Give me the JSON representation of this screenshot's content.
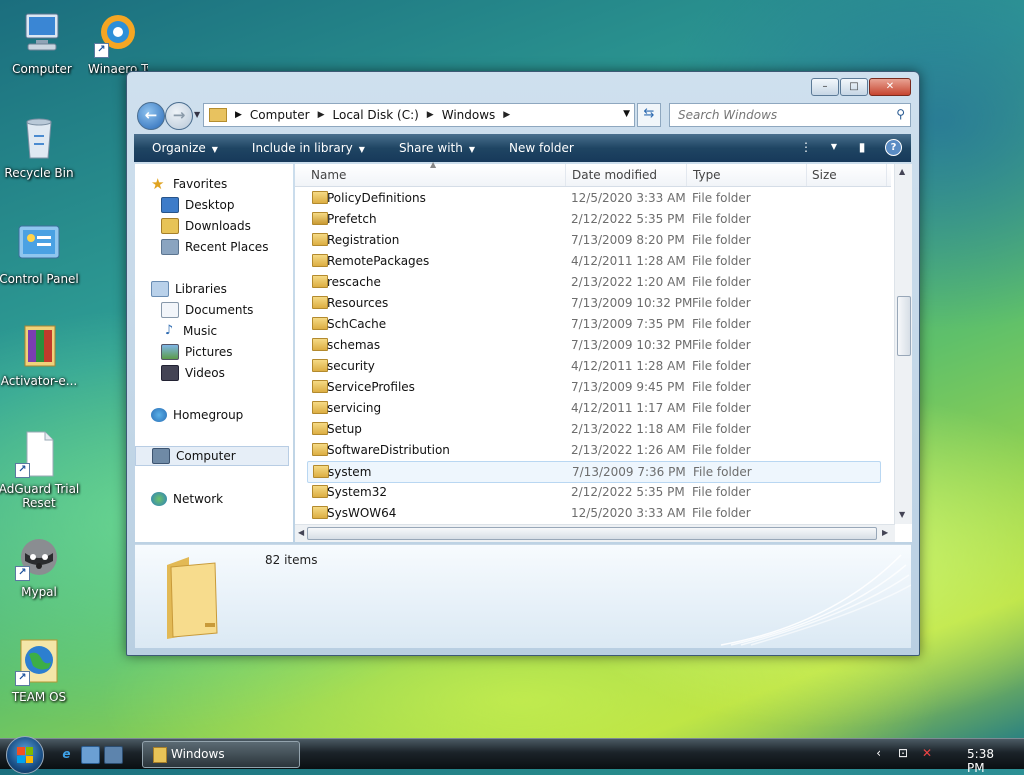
{
  "desktop": {
    "icons": [
      {
        "label": "Computer",
        "icon": "computer-icon"
      },
      {
        "label": "Winaero Tweak",
        "icon": "winaero-tweaker-icon"
      },
      {
        "label": "Recycle Bin",
        "icon": "recycle-bin-icon"
      },
      {
        "label": "Control Panel",
        "icon": "control-panel-icon"
      },
      {
        "label": "Activator-e...",
        "icon": "archive-icon"
      },
      {
        "label": "AdGuard Trial Reset",
        "icon": "file-icon"
      },
      {
        "label": "Mypal",
        "icon": "raccoon-icon"
      },
      {
        "label": "TEAM OS",
        "icon": "globe-icon"
      }
    ]
  },
  "window": {
    "controls": {
      "minimize": "–",
      "maximize": "□",
      "close": "✕"
    },
    "address": {
      "crumbs": [
        "Computer",
        "Local Disk (C:)",
        "Windows"
      ]
    },
    "search": {
      "placeholder": "Search Windows"
    },
    "toolbar": {
      "organize": "Organize",
      "include_in_library": "Include in library",
      "share_with": "Share with",
      "new_folder": "New folder"
    },
    "nav": {
      "favorites": "Favorites",
      "desktop": "Desktop",
      "downloads": "Downloads",
      "recent_places": "Recent Places",
      "libraries": "Libraries",
      "documents": "Documents",
      "music": "Music",
      "pictures": "Pictures",
      "videos": "Videos",
      "homegroup": "Homegroup",
      "computer": "Computer",
      "network": "Network"
    },
    "columns": {
      "name": "Name",
      "date_modified": "Date modified",
      "type": "Type",
      "size": "Size"
    },
    "files": [
      {
        "name": "PolicyDefinitions",
        "date": "12/5/2020 3:33 AM",
        "type": "File folder",
        "locked": false
      },
      {
        "name": "Prefetch",
        "date": "2/12/2022 5:35 PM",
        "type": "File folder",
        "locked": true
      },
      {
        "name": "Registration",
        "date": "7/13/2009 8:20 PM",
        "type": "File folder",
        "locked": false
      },
      {
        "name": "RemotePackages",
        "date": "4/12/2011 1:28 AM",
        "type": "File folder",
        "locked": false
      },
      {
        "name": "rescache",
        "date": "2/13/2022 1:20 AM",
        "type": "File folder",
        "locked": false
      },
      {
        "name": "Resources",
        "date": "7/13/2009 10:32 PM",
        "type": "File folder",
        "locked": false
      },
      {
        "name": "SchCache",
        "date": "7/13/2009 7:35 PM",
        "type": "File folder",
        "locked": false
      },
      {
        "name": "schemas",
        "date": "7/13/2009 10:32 PM",
        "type": "File folder",
        "locked": false
      },
      {
        "name": "security",
        "date": "4/12/2011 1:28 AM",
        "type": "File folder",
        "locked": false
      },
      {
        "name": "ServiceProfiles",
        "date": "7/13/2009 9:45 PM",
        "type": "File folder",
        "locked": false
      },
      {
        "name": "servicing",
        "date": "4/12/2011 1:17 AM",
        "type": "File folder",
        "locked": false
      },
      {
        "name": "Setup",
        "date": "2/13/2022 1:18 AM",
        "type": "File folder",
        "locked": false
      },
      {
        "name": "SoftwareDistribution",
        "date": "2/13/2022 1:26 AM",
        "type": "File folder",
        "locked": false
      },
      {
        "name": "system",
        "date": "7/13/2009 7:36 PM",
        "type": "File folder",
        "locked": false
      },
      {
        "name": "System32",
        "date": "2/12/2022 5:35 PM",
        "type": "File folder",
        "locked": false
      },
      {
        "name": "SysWOW64",
        "date": "12/5/2020 3:33 AM",
        "type": "File folder",
        "locked": false
      }
    ],
    "details": {
      "item_count": "82 items"
    }
  },
  "taskbar": {
    "window_button": "Windows",
    "clock": "5:38 PM"
  }
}
